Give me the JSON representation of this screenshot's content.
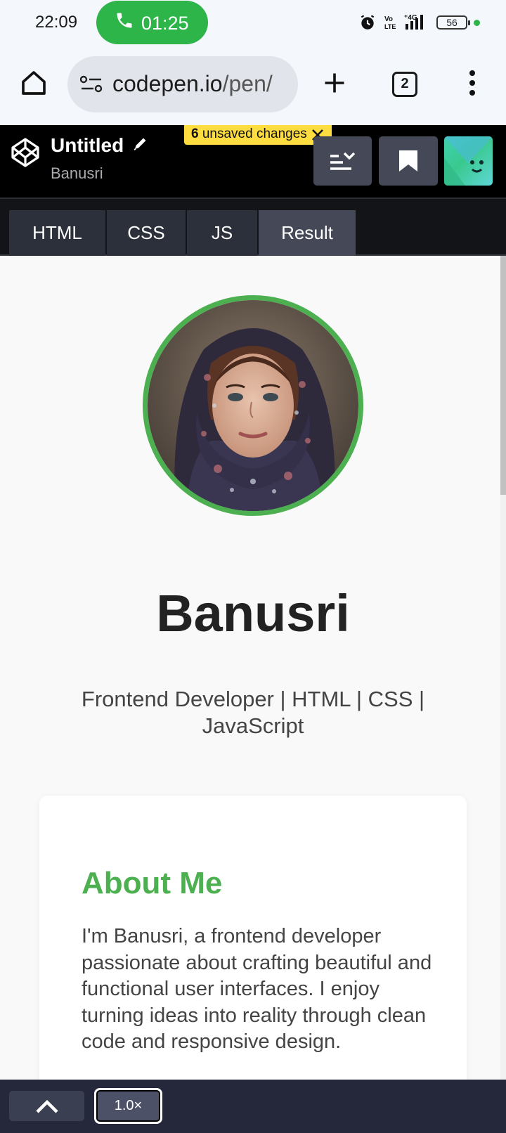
{
  "status_bar": {
    "time": "22:09",
    "call_timer": "01:25",
    "battery": "56",
    "icons": [
      "alarm-icon",
      "volte-icon",
      "4g-signal-icon",
      "battery-icon"
    ]
  },
  "browser": {
    "url_host": "codepen.io",
    "url_path": "/pen/",
    "tab_count": "2"
  },
  "codepen": {
    "title": "Untitled",
    "author": "Banusri",
    "unsaved_count": "6",
    "unsaved_label": " unsaved changes",
    "tabs": [
      {
        "label": "HTML"
      },
      {
        "label": "CSS"
      },
      {
        "label": "JS"
      },
      {
        "label": "Result",
        "active": true
      }
    ]
  },
  "result": {
    "name": "Banusri",
    "tagline": "Frontend Developer | HTML | CSS | JavaScript",
    "about_title": "About Me",
    "about_text": "I'm Banusri, a frontend developer passionate about crafting beautiful and functional user interfaces. I enjoy turning ideas into reality through clean code and responsive design."
  },
  "bottom_bar": {
    "zoom": "1.0×"
  },
  "colors": {
    "accent_green": "#4caf50",
    "call_green": "#2db54a",
    "unsaved_yellow": "#ffdd40"
  }
}
